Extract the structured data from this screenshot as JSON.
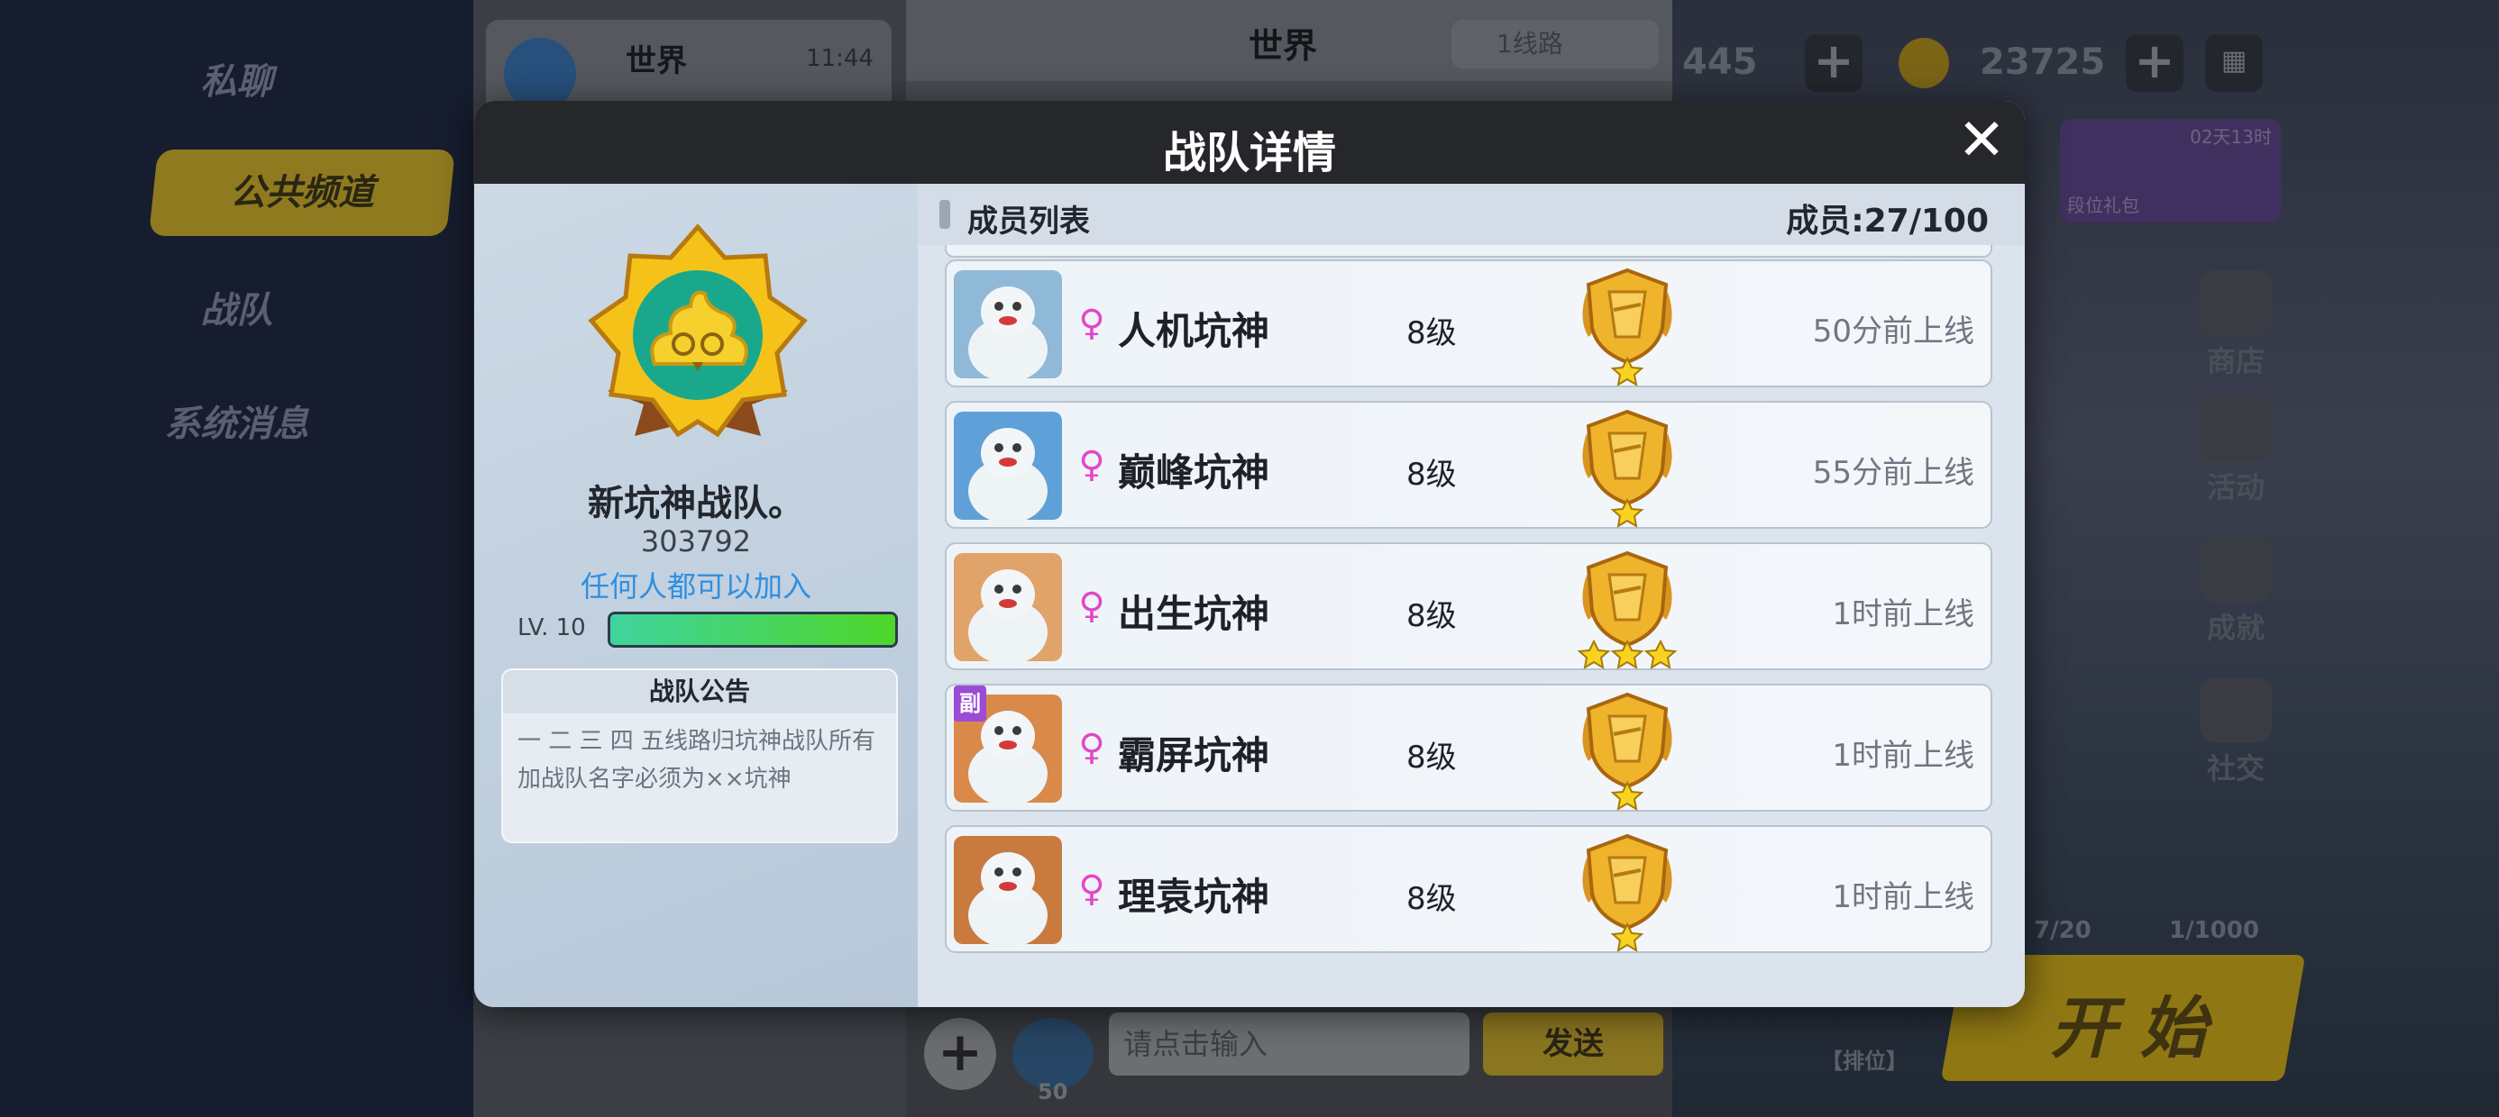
{
  "background": {
    "left_tabs": [
      "私聊",
      "公共频道",
      "战队",
      "系统消息"
    ],
    "chat_list": {
      "name": "世界",
      "time": "11:44"
    },
    "chat": {
      "title": "世界",
      "line_selector": "1线路",
      "input_placeholder": "请点击输入",
      "send_label": "发送",
      "volume": "50"
    },
    "hud": {
      "gems": "445",
      "coins": "23725",
      "gift_timer": "02天13时",
      "gift_label": "段位礼包",
      "side_buttons": [
        "商店",
        "活动",
        "成就",
        "社交"
      ],
      "counter1": "7/20",
      "counter2": "1/1000",
      "start_label": "开 始",
      "rank_tag": "【排位】"
    }
  },
  "dialog": {
    "title": "战队详情",
    "team": {
      "name": "新坑神战队。",
      "id": "303792",
      "join_policy": "任何人都可以加入",
      "level_label": "LV. 10",
      "level_progress": 1.0
    },
    "notice": {
      "title": "战队公告",
      "text": "一 二 三 四 五线路归坑神战队所有加战队名字必须为××坑神"
    },
    "member_list": {
      "title": "成员列表",
      "count": "成员:27/100",
      "members": [
        {
          "name": "人机坑神",
          "level": "8级",
          "last_seen": "50分前上线",
          "stars": 1,
          "vice": false
        },
        {
          "name": "巅峰坑神",
          "level": "8级",
          "last_seen": "55分前上线",
          "stars": 1,
          "vice": false
        },
        {
          "name": "出生坑神",
          "level": "8级",
          "last_seen": "1时前上线",
          "stars": 3,
          "vice": false
        },
        {
          "name": "霸屏坑神",
          "level": "8级",
          "last_seen": "1时前上线",
          "stars": 1,
          "vice": true,
          "vice_label": "副"
        },
        {
          "name": "理袁坑神",
          "level": "8级",
          "last_seen": "1时前上线",
          "stars": 1,
          "vice": false
        }
      ]
    },
    "gender_symbol": "♀",
    "close_symbol": "✕"
  },
  "colors": {
    "accent_blue": "#2f8fe0",
    "gender_pink": "#e246c9",
    "level_green": "#4fd62a",
    "gold": "#e8a92a"
  }
}
